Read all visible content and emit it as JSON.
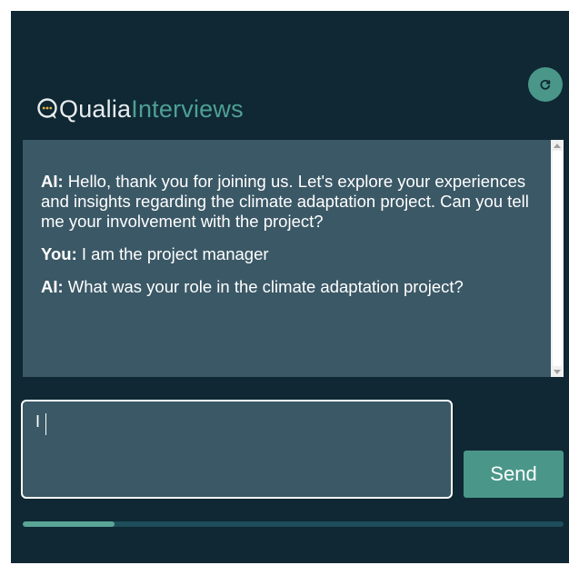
{
  "app": {
    "logo_word_1": "Qualia",
    "logo_word_2": "Interviews",
    "colors": {
      "background": "#0f2833",
      "panel": "#3b5866",
      "accent": "#4a978a",
      "text": "#ffffff"
    }
  },
  "toolbar": {
    "refresh_icon": "refresh-icon"
  },
  "chat": {
    "messages": [
      {
        "speaker": "AI:",
        "text": " Hello, thank you for joining us. Let's explore your experiences and insights regarding the climate adaptation project. Can you tell me your involvement with the project?"
      },
      {
        "speaker": "You:",
        "text": " I am the project manager"
      },
      {
        "speaker": "AI:",
        "text": " What was your role in the climate adaptation project?"
      }
    ]
  },
  "input": {
    "value": "I",
    "placeholder": ""
  },
  "send": {
    "label": "Send"
  },
  "progress": {
    "fraction": 0.17
  }
}
